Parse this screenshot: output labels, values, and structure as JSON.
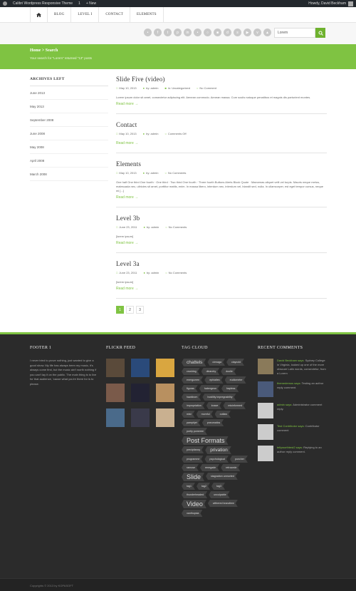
{
  "adminbar": {
    "site_name": "Calibri Wordpress Responsive Theme",
    "comments_count": "1",
    "new_label": "+  New",
    "howdy": "Howdy, David Beckham"
  },
  "nav": {
    "items": [
      "BLOG",
      "LEVEL I",
      "CONTACT",
      "ELEMENTS"
    ]
  },
  "social_icons": [
    "rss",
    "facebook",
    "twitter",
    "pinterest",
    "linkedin",
    "flickr",
    "dribbble",
    "delicious",
    "digg",
    "stumble",
    "youtube",
    "vimeo",
    "forrst"
  ],
  "search": {
    "value": "Lorem"
  },
  "banner": {
    "breadcrumb": "Home > Search",
    "subtitle": "Your search for \"Lorem\" returned \"13\" posts"
  },
  "sidebar": {
    "title": "ARCHIVES LEFT",
    "items": [
      "June 2013",
      "May 2013",
      "September 2008",
      "June 2008",
      "May 2008",
      "April 2008",
      "March 2008"
    ]
  },
  "posts": [
    {
      "title": "Slide Five (video)",
      "date": "May 10, 2013",
      "author": "by: admin",
      "category": "in: Uncategorized",
      "comments": "No Comment",
      "excerpt": "Lorem ipsum dolor sit amet, consectetur adipiscing elit. Aenean commodo. Aenean massa. Cum sociis natoque penatibus et magnis dis parturient montes.",
      "readmore": "Read more →"
    },
    {
      "title": "Contact",
      "date": "May 10, 2013",
      "author": "by: admin",
      "comments": "Comments Off",
      "excerpt": "",
      "readmore": "Read more →"
    },
    {
      "title": "Elements",
      "date": "May 10, 2013",
      "author": "by: admin",
      "comments": "No Comments",
      "excerpt": "One half One third One fourth · One third · Two third One fourth · Three fourth Buttons Alerts Block Quote · Maecenas aliquet velit vel turpis. Mauris neque metus, malesuada nec, ultricies sit amet, porttitor mattis, enim. In massa libero, interdum nec, interdum vel, blandit sed, nulla. In ullamcorper, est eget tempor cursus, neque mi [...]",
      "readmore": "Read more →"
    },
    {
      "title": "Level 3b",
      "date": "June 23, 2011",
      "author": "by: admin",
      "comments": "No Comments",
      "excerpt": "[lorem ipsum]",
      "readmore": "Read more →"
    },
    {
      "title": "Level 3a",
      "date": "June 23, 2011",
      "author": "by: admin",
      "comments": "No Comments",
      "excerpt": "[lorem ipsum]",
      "readmore": "Read more →"
    }
  ],
  "pagination": [
    "1",
    "2",
    "3"
  ],
  "footer": {
    "col1_title": "FOOTER 1",
    "col1_text": "I never tried to prove nothing, just wanted to give a good show. My life has always been my music, it's always come first, but the music ain't worth nothing if you can't lay it on the public. The main thing is to live for that audience, 'cause what you're there for is to please.",
    "col2_title": "FLICKR FEED",
    "col3_title": "TAG CLOUD",
    "col4_title": "RECENT COMMENTS",
    "flickr_colors": [
      "#5a4a3a",
      "#2a4a7a",
      "#d9a640",
      "#7a5a4a",
      "#223",
      "#b89060",
      "#4a6a8a",
      "#3a3a4a",
      "#c9b090"
    ],
    "tags": [
      {
        "t": "chattels",
        "s": "mid"
      },
      {
        "t": "cienaga",
        "s": ""
      },
      {
        "t": "claycold",
        "s": ""
      },
      {
        "t": "crushing",
        "s": ""
      },
      {
        "t": "dinarchy",
        "s": ""
      },
      {
        "t": "doolie",
        "s": ""
      },
      {
        "t": "energumen",
        "s": ""
      },
      {
        "t": "ephialtes",
        "s": ""
      },
      {
        "t": "eudiometer",
        "s": ""
      },
      {
        "t": "figuras",
        "s": ""
      },
      {
        "t": "habergeon",
        "s": ""
      },
      {
        "t": "hapless",
        "s": ""
      },
      {
        "t": "hawkbom",
        "s": ""
      },
      {
        "t": "hostility impregnability",
        "s": ""
      },
      {
        "t": "impropriation",
        "s": ""
      },
      {
        "t": "knave",
        "s": ""
      },
      {
        "t": "misinformed",
        "s": ""
      },
      {
        "t": "mist",
        "s": ""
      },
      {
        "t": "mornful",
        "s": ""
      },
      {
        "t": "outlaw",
        "s": ""
      },
      {
        "t": "pamphjet",
        "s": ""
      },
      {
        "t": "pneumatics",
        "s": ""
      },
      {
        "t": "portly pomeree",
        "s": ""
      },
      {
        "t": "Post Formats",
        "s": "big"
      },
      {
        "t": "precipitancy",
        "s": ""
      },
      {
        "t": "privation",
        "s": "mid"
      },
      {
        "t": "programme",
        "s": ""
      },
      {
        "t": "psychological",
        "s": ""
      },
      {
        "t": "puncher",
        "s": ""
      },
      {
        "t": "ramose",
        "s": ""
      },
      {
        "t": "renegade",
        "s": ""
      },
      {
        "t": "retrocede",
        "s": ""
      },
      {
        "t": "Slide",
        "s": "big"
      },
      {
        "t": "stagnation unmorted",
        "s": ""
      },
      {
        "t": "tag1",
        "s": ""
      },
      {
        "t": "tag2",
        "s": ""
      },
      {
        "t": "tag3",
        "s": ""
      },
      {
        "t": "thunderheaded",
        "s": ""
      },
      {
        "t": "unculpable",
        "s": ""
      },
      {
        "t": "Video",
        "s": "big"
      },
      {
        "t": "withered brandtree",
        "s": ""
      },
      {
        "t": "xanthopsia",
        "s": ""
      }
    ],
    "comments": [
      {
        "name": "David Beckham says:",
        "text": "Sydney College in Virginia, looked up one of the more obscure Latin words, consectetur, from a Lorem",
        "color": "#8a7a5a"
      },
      {
        "name": "themedemos says:",
        "text": "Testing an author reply comment.",
        "color": "#4a5a7a"
      },
      {
        "name": "admin says:",
        "text": "Administrator comment reply.",
        "color": "#ccc"
      },
      {
        "name": "Test Contributor says:",
        "text": "Contributor comment",
        "color": "#ccc"
      },
      {
        "name": "tellyworthtest2 says:",
        "text": "Replying to an author reply comment.",
        "color": "#ccc"
      }
    ],
    "copyright": "Copyrights © 2013 by KOPASOFT"
  },
  "colors": {
    "accent": "#7fc342",
    "footer_bg": "#2b2b2b"
  }
}
